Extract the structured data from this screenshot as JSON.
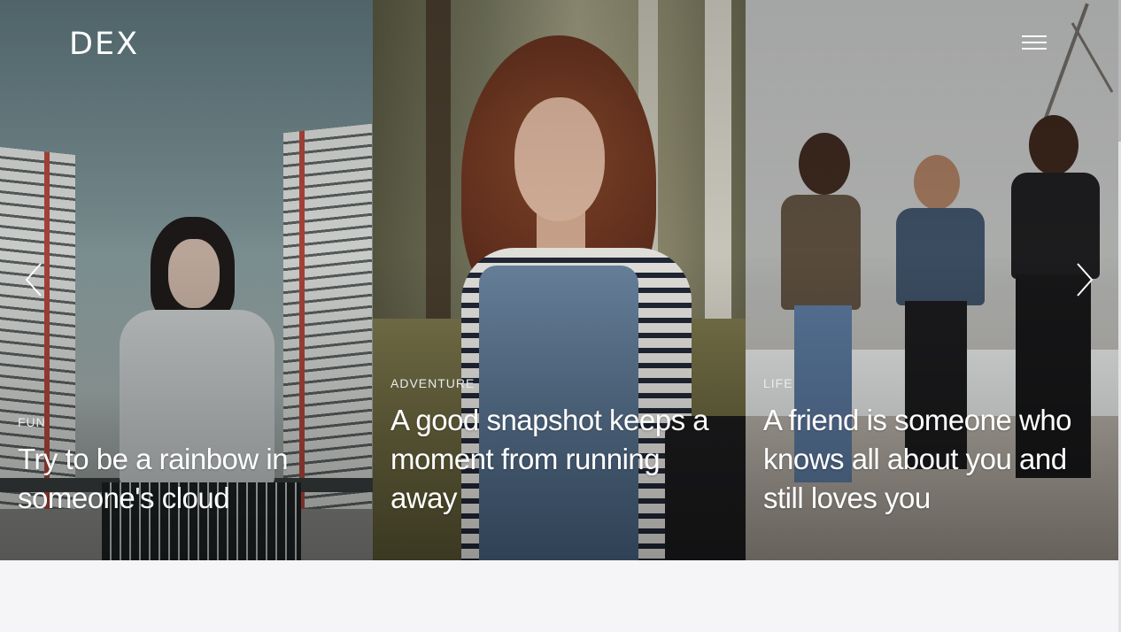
{
  "header": {
    "logo": "DEX",
    "menu_icon": "hamburger-menu-icon"
  },
  "carousel": {
    "prev_icon": "chevron-left-icon",
    "next_icon": "chevron-right-icon",
    "slides": [
      {
        "category": "FUN",
        "title": "Try to be a rainbow in someone's cloud"
      },
      {
        "category": "ADVENTURE",
        "title": "A good snapshot keeps a moment from running away"
      },
      {
        "category": "LIFE",
        "title": "A friend is someone who knows all about you and still loves you"
      }
    ]
  },
  "colors": {
    "caption_text": "#ffffff",
    "page_background": "#f5f5f7"
  }
}
